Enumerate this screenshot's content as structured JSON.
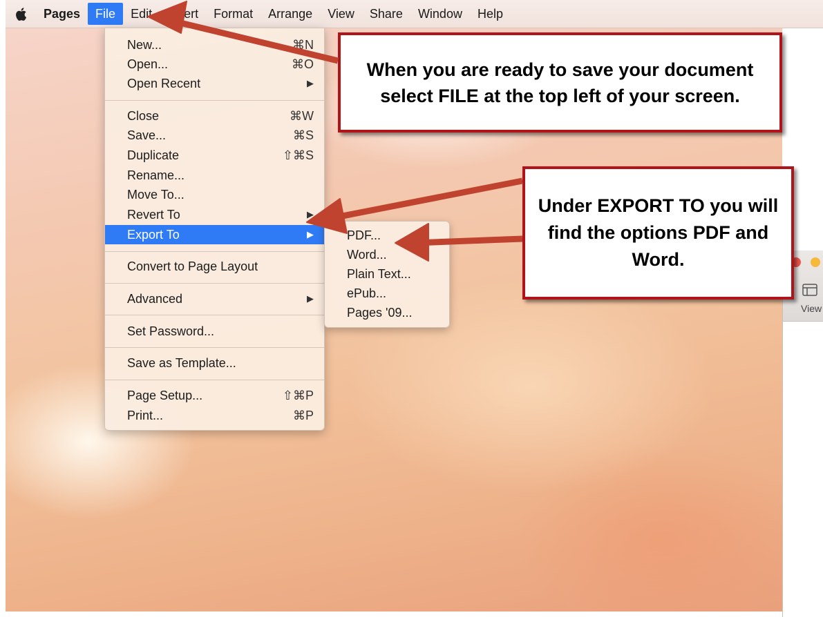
{
  "menubar": {
    "app_name": "Pages",
    "menus": [
      "File",
      "Edit",
      "Insert",
      "Format",
      "Arrange",
      "View",
      "Share",
      "Window",
      "Help"
    ],
    "active_menu": "File"
  },
  "file_menu": {
    "items": [
      {
        "label": "New...",
        "shortcut": "⌘N"
      },
      {
        "label": "Open...",
        "shortcut": "⌘O"
      },
      {
        "label": "Open Recent",
        "shortcut": "▶"
      },
      {
        "label": "Close",
        "shortcut": "⌘W"
      },
      {
        "label": "Save...",
        "shortcut": "⌘S"
      },
      {
        "label": "Duplicate",
        "shortcut": "⇧⌘S"
      },
      {
        "label": "Rename...",
        "shortcut": ""
      },
      {
        "label": "Move To...",
        "shortcut": ""
      },
      {
        "label": "Revert To",
        "shortcut": "▶"
      },
      {
        "label": "Export To",
        "shortcut": "▶"
      },
      {
        "label": "Convert to Page Layout",
        "shortcut": ""
      },
      {
        "label": "Advanced",
        "shortcut": "▶"
      },
      {
        "label": "Set Password...",
        "shortcut": ""
      },
      {
        "label": "Save as Template...",
        "shortcut": ""
      },
      {
        "label": "Page Setup...",
        "shortcut": "⇧⌘P"
      },
      {
        "label": "Print...",
        "shortcut": "⌘P"
      }
    ],
    "highlighted": "Export To"
  },
  "export_submenu": {
    "items": [
      "PDF...",
      "Word...",
      "Plain Text...",
      "ePub...",
      "Pages '09..."
    ]
  },
  "callouts": {
    "top": "When you are ready to save your document select FILE at the top left of your screen.",
    "right": "Under EXPORT TO you will find the options PDF and Word."
  },
  "side_window": {
    "view_label": "View"
  },
  "colors": {
    "menu_highlight": "#2f7bf5",
    "callout_border": "#b0141b",
    "arrow": "#c0432f"
  }
}
